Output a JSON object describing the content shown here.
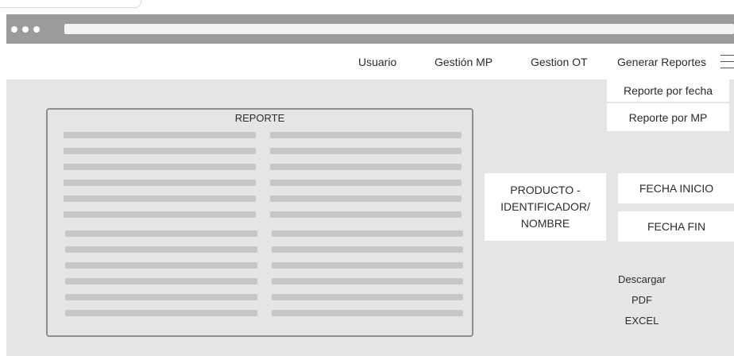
{
  "navbar": {
    "items": [
      {
        "label": "Usuario"
      },
      {
        "label": "Gestión MP"
      },
      {
        "label": "Gestion OT"
      },
      {
        "label": "Generar Reportes"
      }
    ]
  },
  "reports_menu": {
    "items": [
      {
        "label": "Reporte por fecha"
      },
      {
        "label": "Reporte por MP"
      }
    ]
  },
  "report": {
    "title": "REPORTE"
  },
  "filters": {
    "product_lines": [
      "PRODUCTO -",
      "IDENTIFICADOR/",
      "NOMBRE"
    ],
    "start_date_label": "FECHA INICIO",
    "end_date_label": "FECHA FIN"
  },
  "download": {
    "title": "Descargar",
    "options": [
      {
        "label": "PDF"
      },
      {
        "label": "EXCEL"
      }
    ]
  }
}
